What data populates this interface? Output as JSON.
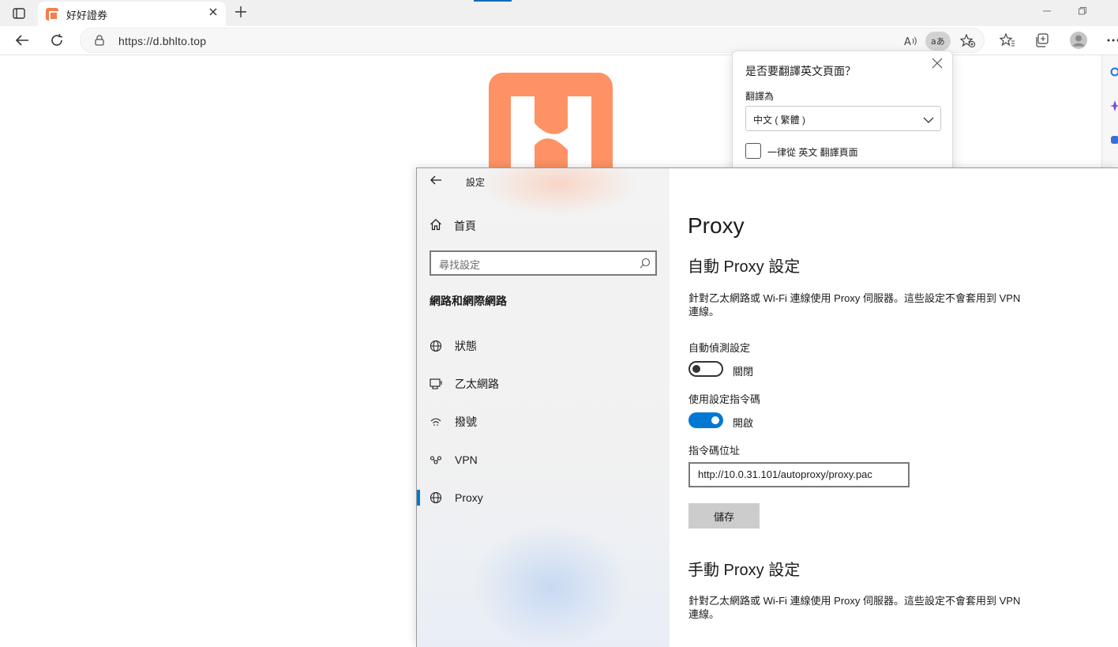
{
  "browser": {
    "tab_title": "好好證券",
    "url": "https://d.bhlto.top",
    "icons": {
      "tab_actions": "tab-actions-icon",
      "favicon": "site-favicon",
      "close_tab": "close-icon",
      "new_tab": "plus-icon",
      "back": "back-arrow-icon",
      "refresh": "refresh-icon",
      "lock": "lock-icon",
      "read_aloud": "read-aloud-icon",
      "translate": "translate-icon",
      "add_favorite": "star-plus-icon",
      "favorites": "favorites-icon",
      "collections": "collections-icon",
      "profile": "profile-avatar",
      "more": "more-icon"
    },
    "accent_color": "#0f6cbd"
  },
  "page": {
    "logo_color": "#fe9265"
  },
  "translate_popup": {
    "title": "是否要翻譯英文頁面？",
    "translate_to_label": "翻譯為",
    "selected_language": "中文 ( 繁體 )",
    "always_translate_label": "一律從 英文 翻譯頁面"
  },
  "settings": {
    "window_title": "設定",
    "home_label": "首頁",
    "search_placeholder": "尋找設定",
    "section_title": "網路和網際網路",
    "nav_items": [
      {
        "label": "狀態",
        "icon": "globe-status-icon"
      },
      {
        "label": "乙太網路",
        "icon": "ethernet-icon"
      },
      {
        "label": "撥號",
        "icon": "dialup-icon"
      },
      {
        "label": "VPN",
        "icon": "vpn-icon"
      },
      {
        "label": "Proxy",
        "icon": "globe-icon",
        "selected": true
      }
    ],
    "page_title": "Proxy",
    "auto_section": {
      "title": "自動 Proxy 設定",
      "description": "針對乙太網路或 Wi-Fi 連線使用 Proxy 伺服器。這些設定不會套用到 VPN 連線。",
      "auto_detect_label": "自動偵測設定",
      "auto_detect_state": "關閉",
      "auto_detect_on": false,
      "use_script_label": "使用設定指令碼",
      "use_script_state": "開啟",
      "use_script_on": true,
      "script_address_label": "指令碼位址",
      "script_address_value": "http://10.0.31.101/autoproxy/proxy.pac",
      "save_label": "儲存"
    },
    "manual_section": {
      "title": "手動 Proxy 設定",
      "description": "針對乙太網路或 Wi-Fi 連線使用 Proxy 伺服器。這些設定不會套用到 VPN 連線。"
    },
    "accent_color": "#0078d4"
  }
}
